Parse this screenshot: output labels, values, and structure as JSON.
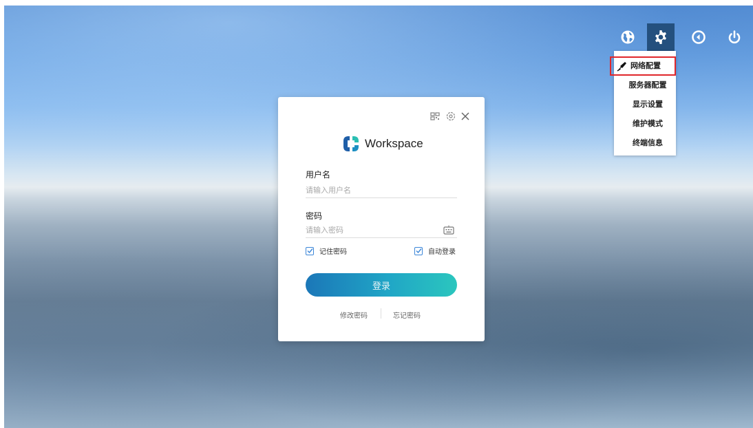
{
  "toolbar": {
    "icons": [
      "globe-icon",
      "gear-icon",
      "back-icon",
      "power-icon"
    ],
    "active_color": "#24507e"
  },
  "settings_menu": {
    "items": [
      "网络配置",
      "服务器配置",
      "显示设置",
      "维护模式",
      "终端信息"
    ],
    "selected": "网络配置",
    "highlight_color": "#e0262a"
  },
  "login": {
    "brand": "Workspace",
    "username_label": "用户名",
    "username_placeholder": "请输入用户名",
    "password_label": "密码",
    "password_placeholder": "请输入密码",
    "remember_label": "记住密码",
    "remember_checked": true,
    "autologin_label": "自动登录",
    "autologin_checked": true,
    "login_button": "登录",
    "change_password": "修改密码",
    "forgot_password": "忘记密码"
  }
}
